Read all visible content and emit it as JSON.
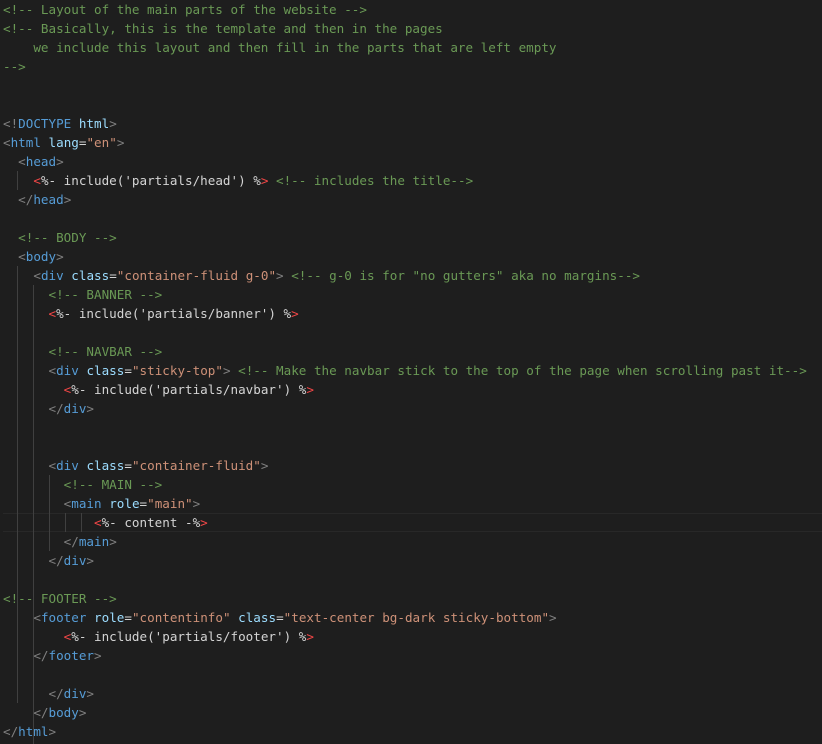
{
  "editor": {
    "language": "ejs",
    "theme": "dark",
    "colors": {
      "background": "#1e1e1e",
      "comment": "#6a9955",
      "bracket": "#808080",
      "tag": "#569cd6",
      "attribute": "#9cdcfe",
      "string": "#ce9178",
      "text": "#d4d4d4",
      "ejs_delimiter": "#f44747"
    },
    "current_line_index": 27,
    "lines": [
      [
        [
          "comment",
          "<!-- Layout of the main parts of the website -->"
        ]
      ],
      [
        [
          "comment",
          "<!-- Basically, this is the template and then in the pages"
        ]
      ],
      [
        [
          "comment",
          "    we include this layout and then fill in the parts that are left empty"
        ]
      ],
      [
        [
          "comment",
          "-->"
        ]
      ],
      [],
      [],
      [
        [
          "bracket",
          "<!"
        ],
        [
          "tag",
          "DOCTYPE"
        ],
        [
          "text",
          " "
        ],
        [
          "attr",
          "html"
        ],
        [
          "bracket",
          ">"
        ]
      ],
      [
        [
          "bracket",
          "<"
        ],
        [
          "tag",
          "html"
        ],
        [
          "text",
          " "
        ],
        [
          "attr",
          "lang"
        ],
        [
          "text",
          "="
        ],
        [
          "string",
          "\"en\""
        ],
        [
          "bracket",
          ">"
        ]
      ],
      [
        [
          "text",
          "  "
        ],
        [
          "bracket",
          "<"
        ],
        [
          "tag",
          "head"
        ],
        [
          "bracket",
          ">"
        ]
      ],
      [
        [
          "text",
          "    "
        ],
        [
          "ejs",
          "<"
        ],
        [
          "text",
          "%- include('partials/head') %"
        ],
        [
          "ejs",
          ">"
        ],
        [
          "text",
          " "
        ],
        [
          "comment",
          "<!-- includes the title-->"
        ]
      ],
      [
        [
          "text",
          "  "
        ],
        [
          "bracket",
          "</"
        ],
        [
          "tag",
          "head"
        ],
        [
          "bracket",
          ">"
        ]
      ],
      [],
      [
        [
          "text",
          "  "
        ],
        [
          "comment",
          "<!-- BODY -->"
        ]
      ],
      [
        [
          "text",
          "  "
        ],
        [
          "bracket",
          "<"
        ],
        [
          "tag",
          "body"
        ],
        [
          "bracket",
          ">"
        ]
      ],
      [
        [
          "text",
          "    "
        ],
        [
          "bracket",
          "<"
        ],
        [
          "tag",
          "div"
        ],
        [
          "text",
          " "
        ],
        [
          "attr",
          "class"
        ],
        [
          "text",
          "="
        ],
        [
          "string",
          "\"container-fluid g-0\""
        ],
        [
          "bracket",
          ">"
        ],
        [
          "text",
          " "
        ],
        [
          "comment",
          "<!-- g-0 is for \"no gutters\" aka no margins-->"
        ]
      ],
      [
        [
          "text",
          "      "
        ],
        [
          "comment",
          "<!-- BANNER -->"
        ]
      ],
      [
        [
          "text",
          "      "
        ],
        [
          "ejs",
          "<"
        ],
        [
          "text",
          "%- include('partials/banner') %"
        ],
        [
          "ejs",
          ">"
        ]
      ],
      [],
      [
        [
          "text",
          "      "
        ],
        [
          "comment",
          "<!-- NAVBAR -->"
        ]
      ],
      [
        [
          "text",
          "      "
        ],
        [
          "bracket",
          "<"
        ],
        [
          "tag",
          "div"
        ],
        [
          "text",
          " "
        ],
        [
          "attr",
          "class"
        ],
        [
          "text",
          "="
        ],
        [
          "string",
          "\"sticky-top\""
        ],
        [
          "bracket",
          ">"
        ],
        [
          "text",
          " "
        ],
        [
          "comment",
          "<!-- Make the navbar stick to the top of the page when scrolling past it-->"
        ]
      ],
      [
        [
          "text",
          "        "
        ],
        [
          "ejs",
          "<"
        ],
        [
          "text",
          "%- include('partials/navbar') %"
        ],
        [
          "ejs",
          ">"
        ]
      ],
      [
        [
          "text",
          "      "
        ],
        [
          "bracket",
          "</"
        ],
        [
          "tag",
          "div"
        ],
        [
          "bracket",
          ">"
        ]
      ],
      [],
      [],
      [
        [
          "text",
          "      "
        ],
        [
          "bracket",
          "<"
        ],
        [
          "tag",
          "div"
        ],
        [
          "text",
          " "
        ],
        [
          "attr",
          "class"
        ],
        [
          "text",
          "="
        ],
        [
          "string",
          "\"container-fluid\""
        ],
        [
          "bracket",
          ">"
        ]
      ],
      [
        [
          "text",
          "        "
        ],
        [
          "comment",
          "<!-- MAIN -->"
        ]
      ],
      [
        [
          "text",
          "        "
        ],
        [
          "bracket",
          "<"
        ],
        [
          "tag",
          "main"
        ],
        [
          "text",
          " "
        ],
        [
          "attr",
          "role"
        ],
        [
          "text",
          "="
        ],
        [
          "string",
          "\"main\""
        ],
        [
          "bracket",
          ">"
        ]
      ],
      [
        [
          "text",
          "            "
        ],
        [
          "ejs",
          "<"
        ],
        [
          "text",
          "%- content -%"
        ],
        [
          "ejs",
          ">"
        ]
      ],
      [
        [
          "text",
          "        "
        ],
        [
          "bracket",
          "</"
        ],
        [
          "tag",
          "main"
        ],
        [
          "bracket",
          ">"
        ]
      ],
      [
        [
          "text",
          "      "
        ],
        [
          "bracket",
          "</"
        ],
        [
          "tag",
          "div"
        ],
        [
          "bracket",
          ">"
        ]
      ],
      [],
      [
        [
          "comment",
          "<!-- FOOTER -->"
        ]
      ],
      [
        [
          "text",
          "    "
        ],
        [
          "bracket",
          "<"
        ],
        [
          "tag",
          "footer"
        ],
        [
          "text",
          " "
        ],
        [
          "attr",
          "role"
        ],
        [
          "text",
          "="
        ],
        [
          "string",
          "\"contentinfo\""
        ],
        [
          "text",
          " "
        ],
        [
          "attr",
          "class"
        ],
        [
          "text",
          "="
        ],
        [
          "string",
          "\"text-center bg-dark sticky-bottom\""
        ],
        [
          "bracket",
          ">"
        ]
      ],
      [
        [
          "text",
          "        "
        ],
        [
          "ejs",
          "<"
        ],
        [
          "text",
          "%- include('partials/footer') %"
        ],
        [
          "ejs",
          ">"
        ]
      ],
      [
        [
          "text",
          "    "
        ],
        [
          "bracket",
          "</"
        ],
        [
          "tag",
          "footer"
        ],
        [
          "bracket",
          ">"
        ]
      ],
      [],
      [
        [
          "text",
          "      "
        ],
        [
          "bracket",
          "</"
        ],
        [
          "tag",
          "div"
        ],
        [
          "bracket",
          ">"
        ]
      ],
      [
        [
          "text",
          "    "
        ],
        [
          "bracket",
          "</"
        ],
        [
          "tag",
          "body"
        ],
        [
          "bracket",
          ">"
        ]
      ],
      [
        [
          "bracket",
          "</"
        ],
        [
          "tag",
          "html"
        ],
        [
          "bracket",
          ">"
        ]
      ]
    ]
  }
}
